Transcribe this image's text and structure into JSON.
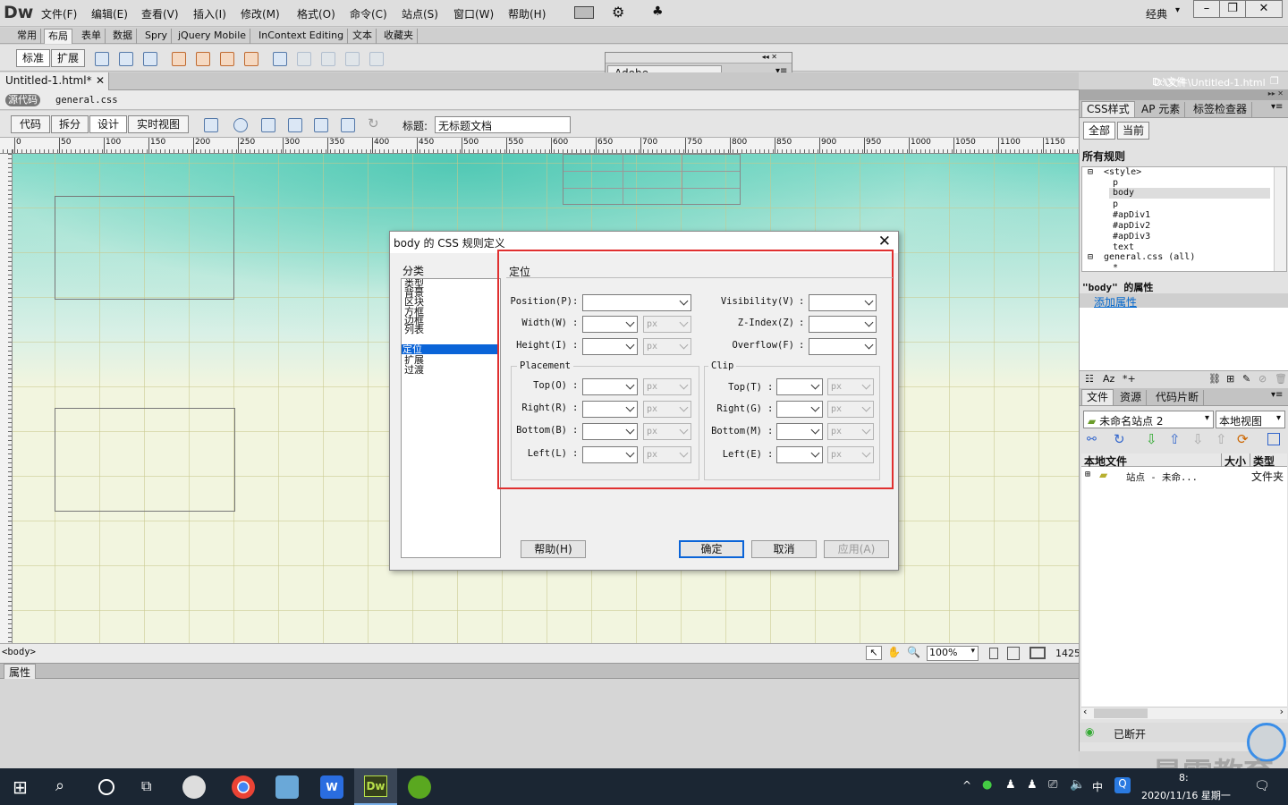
{
  "app": {
    "logo": "Dw",
    "workspace": "经典"
  },
  "menu": [
    "文件(F)",
    "编辑(E)",
    "查看(V)",
    "插入(I)",
    "修改(M)",
    "格式(O)",
    "命令(C)",
    "站点(S)",
    "窗口(W)",
    "帮助(H)"
  ],
  "insert_tabs": [
    "常用",
    "布局",
    "表单",
    "数据",
    "Spry",
    "jQuery Mobile",
    "InContext Editing",
    "文本",
    "收藏夹"
  ],
  "layout_buttons": {
    "standard": "标准",
    "expanded": "扩展"
  },
  "browserlab": {
    "title": "Adobe BrowserLab"
  },
  "document": {
    "tab": "Untitled-1.html*",
    "path": "D:\\文件\\Untitled-1.html",
    "source_code": "源代码",
    "css_file": "general.css"
  },
  "views": {
    "code": "代码",
    "split": "拆分",
    "design": "设计",
    "live": "实时视图",
    "title_label": "标题:",
    "title_value": "无标题文档"
  },
  "ruler_ticks": [
    "0",
    "50",
    "100",
    "150",
    "200",
    "250",
    "300",
    "350",
    "400",
    "450",
    "500",
    "550",
    "600",
    "650",
    "700",
    "750",
    "800",
    "850",
    "900",
    "950",
    "1000",
    "1050",
    "1100",
    "1150"
  ],
  "status": {
    "tag": "<body>",
    "zoom": "100%",
    "width": "1425"
  },
  "properties": {
    "label": "属性"
  },
  "css_panel": {
    "tabs": [
      "CSS样式",
      "AP 元素",
      "标签检查器"
    ],
    "modes": [
      "全部",
      "当前"
    ],
    "rules_header": "所有规则",
    "tree": [
      "<style>",
      "p",
      "body",
      "p",
      "#apDiv1",
      "#apDiv2",
      "#apDiv3",
      "text",
      "general.css (all)",
      "*"
    ],
    "props_header": "\"body\" 的属性",
    "add_property": "添加属性"
  },
  "files_panel": {
    "tabs": [
      "文件",
      "资源",
      "代码片断"
    ],
    "site": "未命名站点 2",
    "view": "本地视图",
    "col_local": "本地文件",
    "col_size": "大小",
    "col_type": "类型",
    "row_name": "站点 - 未命...",
    "row_type": "文件夹",
    "status": "已断开"
  },
  "dialog": {
    "title": "body 的 CSS 规则定义",
    "category_label": "分类",
    "categories": [
      "类型",
      "背景",
      "区块",
      "方框",
      "边框",
      "列表",
      "定位",
      "扩展",
      "过渡"
    ],
    "selected_category": "定位",
    "section": "定位",
    "fields_left": [
      "Position(P)",
      "Width(W)",
      "Height(I)"
    ],
    "fields_right": [
      "Visibility(V)",
      "Z-Index(Z)",
      "Overflow(F)"
    ],
    "placement": {
      "label": "Placement",
      "fields": [
        "Top(O)",
        "Right(R)",
        "Bottom(B)",
        "Left(L)"
      ]
    },
    "clip": {
      "label": "Clip",
      "fields": [
        "Top(T)",
        "Right(G)",
        "Bottom(M)",
        "Left(E)"
      ]
    },
    "unit": "px",
    "buttons": {
      "help": "帮助(H)",
      "ok": "确定",
      "cancel": "取消",
      "apply": "应用(A)"
    }
  },
  "taskbar": {
    "ime": "中",
    "date": "2020/11/16 星期一",
    "time": "8:"
  },
  "watermark": "最需教育"
}
